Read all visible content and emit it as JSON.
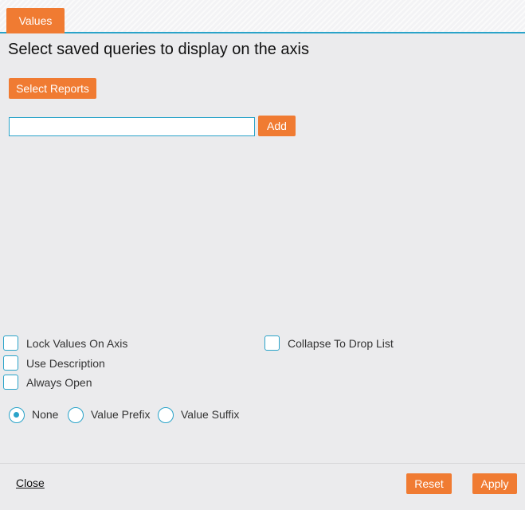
{
  "tabs": [
    {
      "label": "Values",
      "active": true
    }
  ],
  "title": "Select saved queries to display on the axis",
  "select_reports_label": "Select Reports",
  "query_input": {
    "value": "",
    "placeholder": ""
  },
  "add_label": "Add",
  "checkboxes": {
    "lock_values": {
      "label": "Lock Values On Axis",
      "checked": false
    },
    "use_description": {
      "label": "Use Description",
      "checked": false
    },
    "always_open": {
      "label": "Always Open",
      "checked": false
    },
    "collapse_drop_list": {
      "label": "Collapse To Drop List",
      "checked": false
    }
  },
  "radios": {
    "selected": "None",
    "options": [
      "None",
      "Value Prefix",
      "Value Suffix"
    ]
  },
  "footer": {
    "close_label": "Close",
    "reset_label": "Reset",
    "apply_label": "Apply"
  },
  "colors": {
    "accent": "#f07b32",
    "focus": "#2aa3c9",
    "background": "#ebebed"
  }
}
